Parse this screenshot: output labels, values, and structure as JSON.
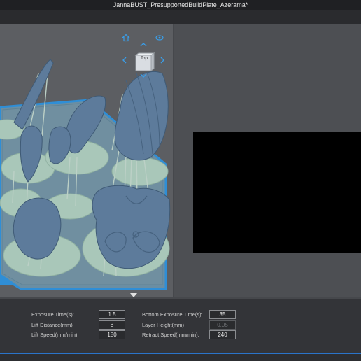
{
  "window": {
    "title": "JannaBUST_PresupportedBuildPlate_Azerama*"
  },
  "view_cube": {
    "face_label": "Top"
  },
  "viewport_icons": [
    "home-icon",
    "eye-icon",
    "arrow-up-icon",
    "arrow-left-icon",
    "arrow-right-icon",
    "arrow-down-icon"
  ],
  "settings": {
    "exposure_time": {
      "label": "Exposure Time(s):",
      "value": "1.5"
    },
    "lift_distance": {
      "label": "Lift Distance(mm)",
      "value": "8"
    },
    "lift_speed": {
      "label": "Lift Speed(mm/min):",
      "value": "180"
    },
    "bottom_exposure_time": {
      "label": "Bottom Exposure Time(s):",
      "value": "35"
    },
    "layer_height": {
      "label": "Layer Height(mm)",
      "value": "0.05"
    },
    "retract_speed": {
      "label": "Retract Speed(mm/min):",
      "value": "240"
    }
  },
  "colors": {
    "accent": "#2b74c9",
    "model": "#5d7b9b",
    "supports": "#a9c7b9",
    "build_plate_border": "#2f8ed6",
    "preview_background": "#000000"
  }
}
